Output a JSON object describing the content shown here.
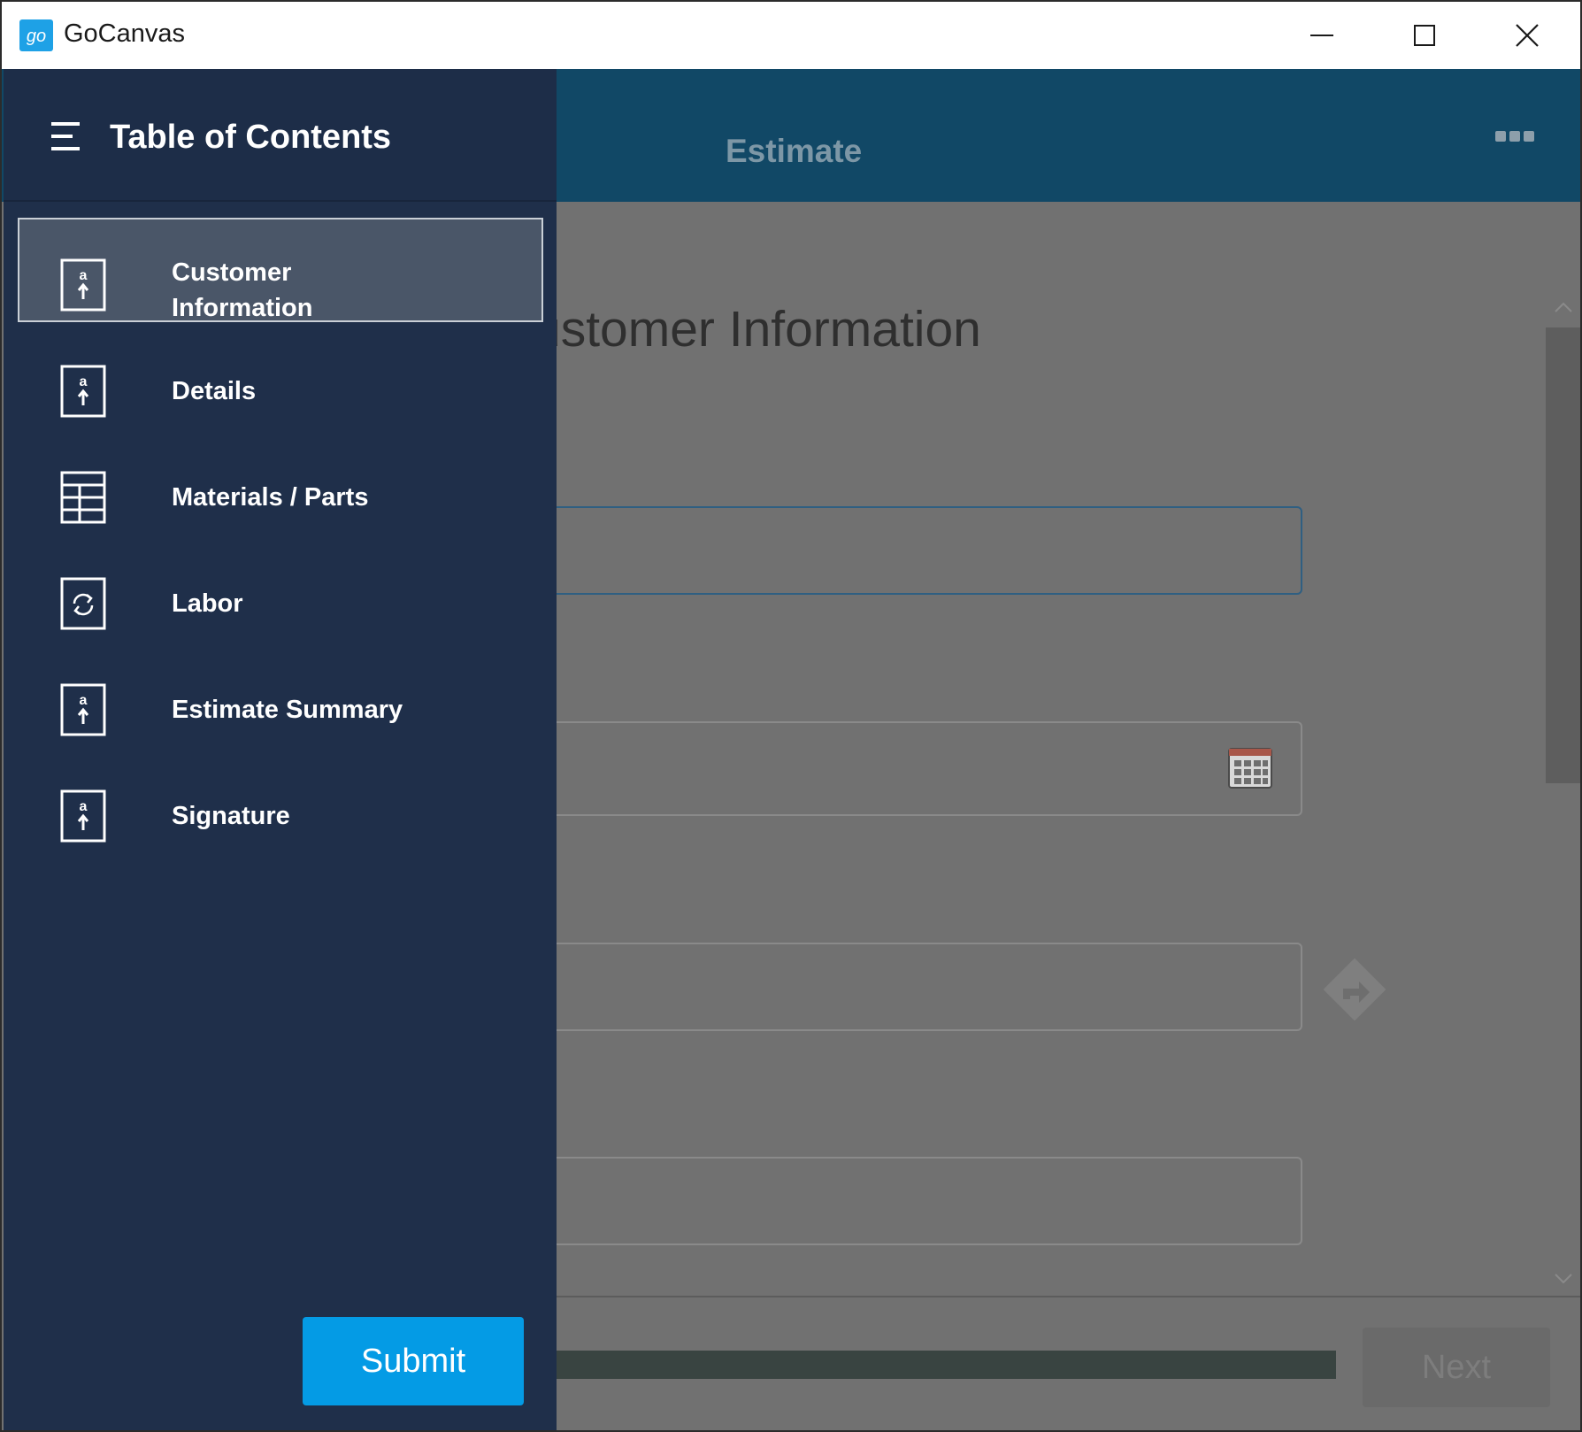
{
  "window": {
    "title": "GoCanvas",
    "logo_icon": "gocanvas-logo-icon",
    "controls": [
      "minimize-icon",
      "maximize-icon",
      "close-icon"
    ]
  },
  "header": {
    "title": "Estimate",
    "more_icon": "more-options-icon",
    "color": "#114866"
  },
  "main": {
    "heading": "ustomer Information",
    "next_label": "Next",
    "field_icons": [
      "calendar-icon",
      "directions-icon"
    ]
  },
  "toc": {
    "title": "Table of Contents",
    "menu_icon": "menu-icon",
    "items": [
      {
        "label_line1": "Customer",
        "label_line2": "Information",
        "icon": "text-field-icon",
        "selected": true
      },
      {
        "label": "Details",
        "icon": "text-field-icon"
      },
      {
        "label": "Materials / Parts",
        "icon": "table-icon"
      },
      {
        "label": "Labor",
        "icon": "refresh-icon"
      },
      {
        "label": "Estimate Summary",
        "icon": "text-field-icon"
      },
      {
        "label": "Signature",
        "icon": "text-field-icon"
      }
    ],
    "submit_label": "Submit",
    "background": "#1f2f4a",
    "accent": "#049be5"
  }
}
